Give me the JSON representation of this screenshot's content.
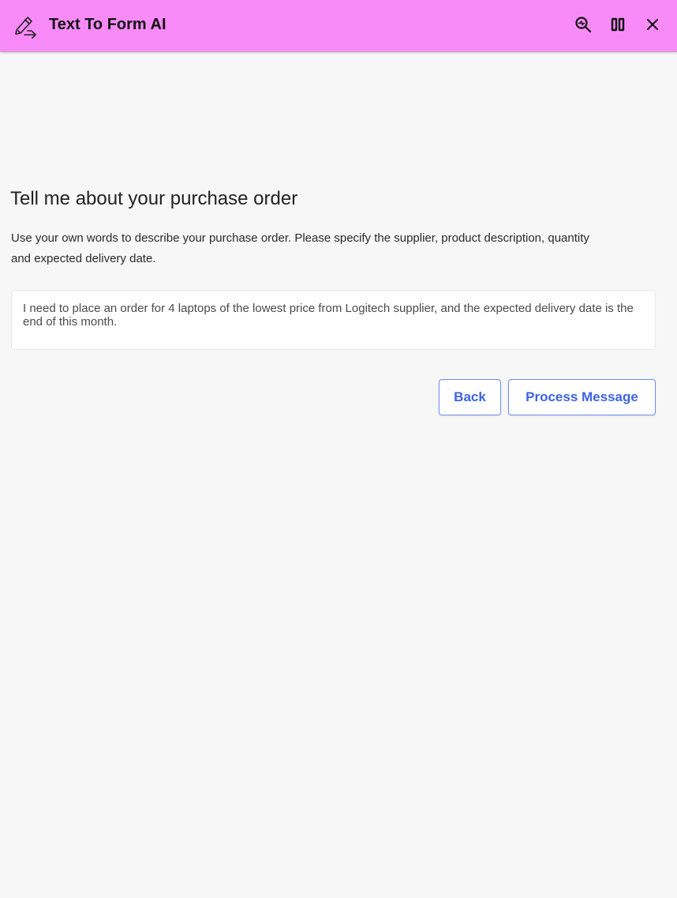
{
  "header": {
    "title": "Text To Form AI",
    "background_color": "#f98bf9",
    "logo_icon": "pencil-arrow-icon",
    "actions": [
      {
        "name": "search-icon",
        "label": ""
      },
      {
        "name": "columns-icon",
        "label": ""
      },
      {
        "name": "close-icon",
        "label": ""
      }
    ]
  },
  "main": {
    "heading": "Tell me about your purchase order",
    "description": "Use your own words to describe your purchase order.  Please specify the supplier, product description, quantity and expected delivery date.",
    "message": {
      "value": "I need to place an order for 4 laptops of the lowest price from Logitech supplier, and the expected delivery date is the end of this month."
    },
    "buttons": {
      "back_label": "Back",
      "process_label": "Process Message"
    },
    "accent_color": "#3d63e3"
  }
}
